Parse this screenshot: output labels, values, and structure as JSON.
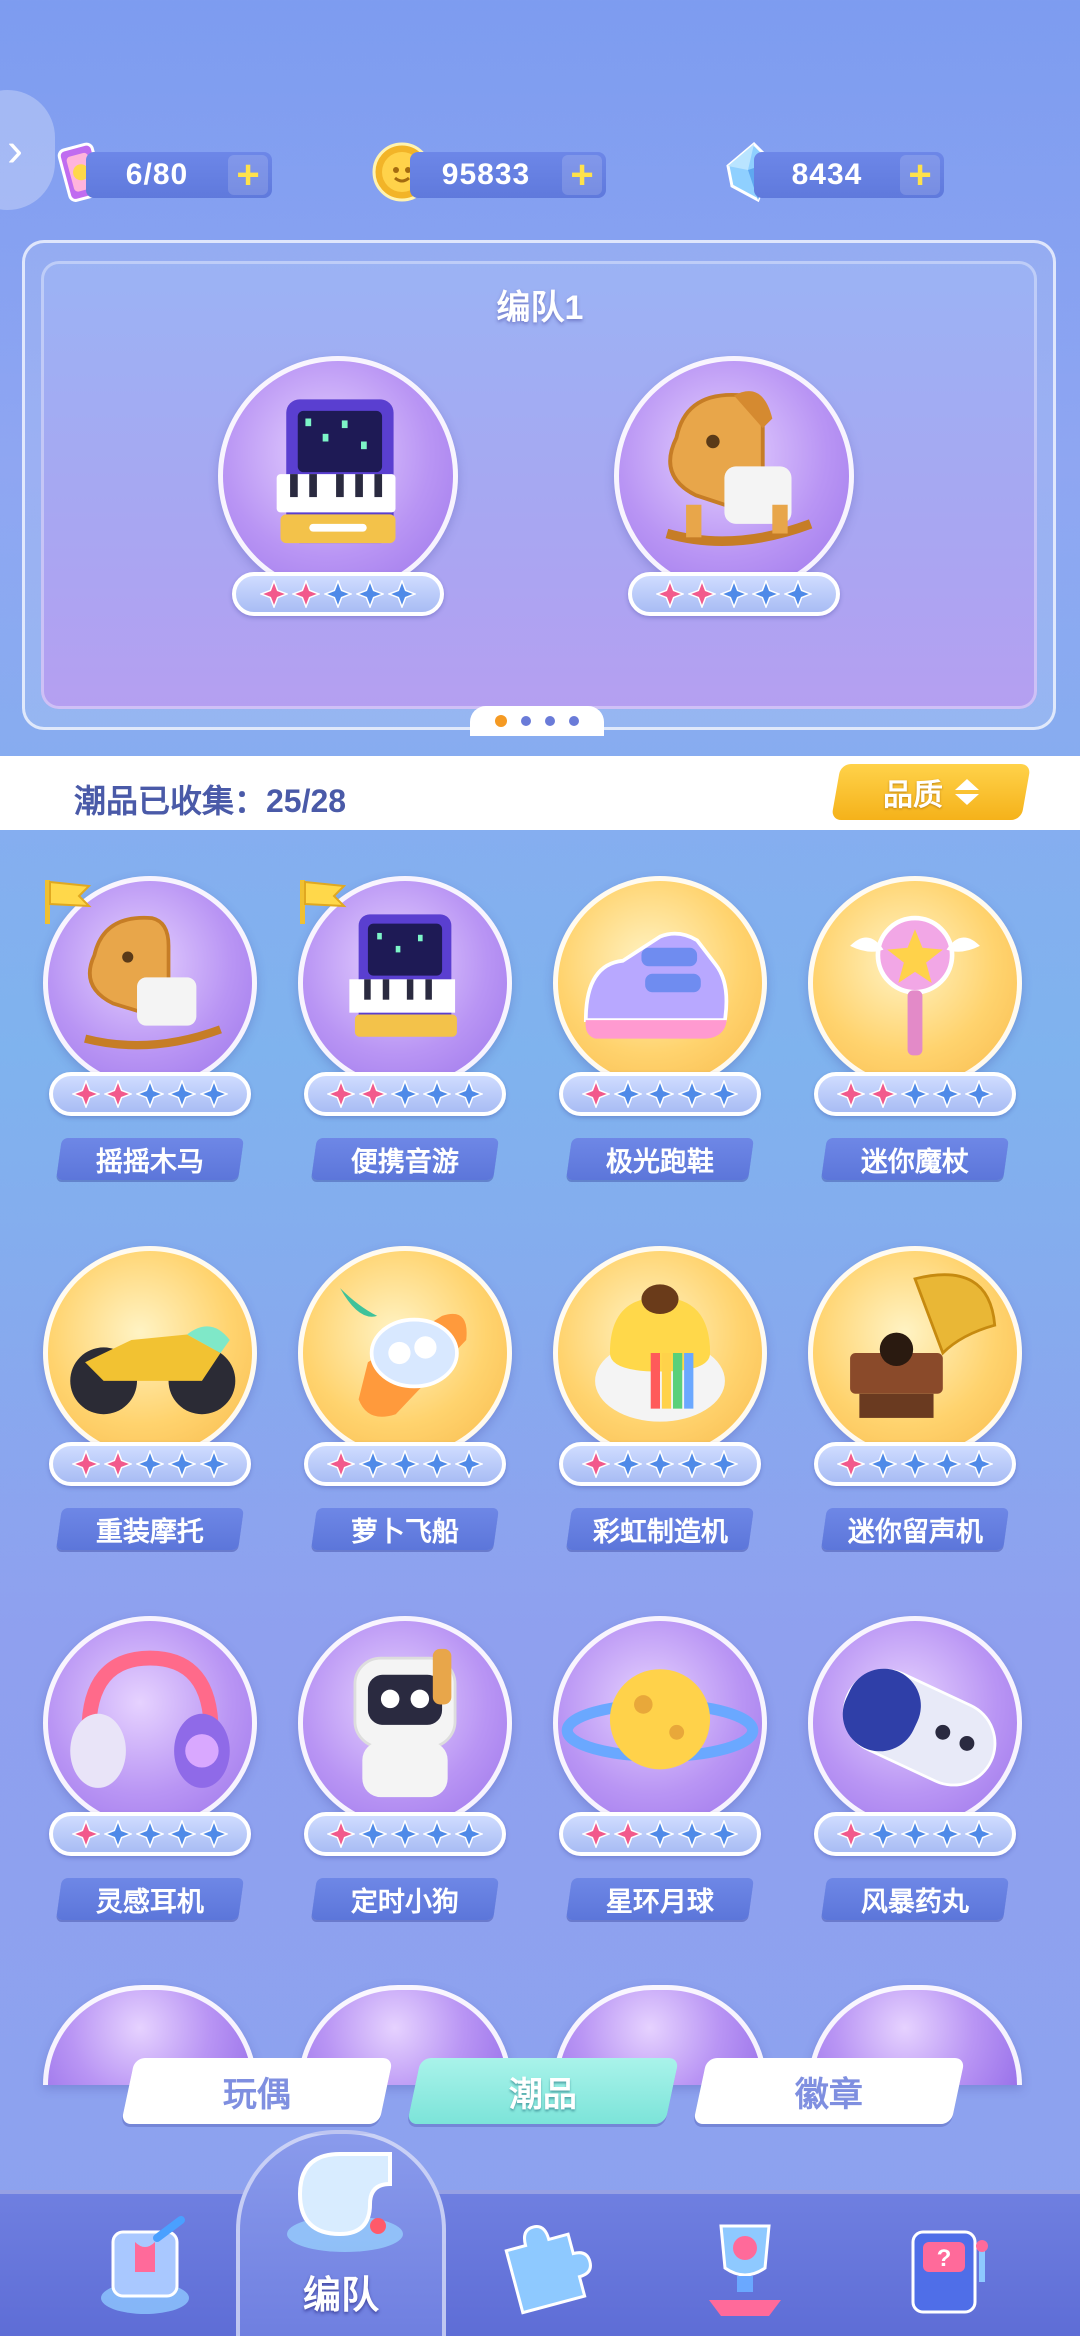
{
  "resources": {
    "energy": {
      "value": "6/80",
      "icon": "ticket-icon"
    },
    "coins": {
      "value": "95833",
      "icon": "coin-icon"
    },
    "gems": {
      "value": "8434",
      "icon": "crystal-icon"
    },
    "plus": "+"
  },
  "side_toggle": "›",
  "team": {
    "title": "编队1",
    "pages": 4,
    "active_page": 1,
    "slots": [
      {
        "item": "便携音游",
        "stars": 2,
        "max_stars": 5
      },
      {
        "item": "摇摇木马",
        "stars": 2,
        "max_stars": 5
      }
    ]
  },
  "collection": {
    "label": "潮品已收集：25/28",
    "sort_button": "品质"
  },
  "items": [
    {
      "name": "摇摇木马",
      "stars": 2,
      "bg": "purple",
      "flag": true
    },
    {
      "name": "便携音游",
      "stars": 2,
      "bg": "purple",
      "flag": true
    },
    {
      "name": "极光跑鞋",
      "stars": 1,
      "bg": "gold",
      "flag": false
    },
    {
      "name": "迷你魔杖",
      "stars": 2,
      "bg": "gold",
      "flag": false
    },
    {
      "name": "重装摩托",
      "stars": 2,
      "bg": "gold",
      "flag": false
    },
    {
      "name": "萝卜飞船",
      "stars": 1,
      "bg": "gold",
      "flag": false
    },
    {
      "name": "彩虹制造机",
      "stars": 1,
      "bg": "gold",
      "flag": false
    },
    {
      "name": "迷你留声机",
      "stars": 1,
      "bg": "gold",
      "flag": false
    },
    {
      "name": "灵感耳机",
      "stars": 1,
      "bg": "purple",
      "flag": false
    },
    {
      "name": "定时小狗",
      "stars": 1,
      "bg": "purple",
      "flag": false
    },
    {
      "name": "星环月球",
      "stars": 2,
      "bg": "purple",
      "flag": false
    },
    {
      "name": "风暴药丸",
      "stars": 1,
      "bg": "purple",
      "flag": false
    }
  ],
  "tabs": [
    {
      "label": "玩偶",
      "active": false
    },
    {
      "label": "潮品",
      "active": true
    },
    {
      "label": "徽章",
      "active": false
    }
  ],
  "bottom_nav": {
    "active_label": "编队",
    "items": [
      "rocket-icon",
      "whistle-icon",
      "puzzle-icon",
      "trophy-icon",
      "slot-machine-icon"
    ]
  },
  "colors": {
    "star_on": "#f25a8c",
    "star_off": "#4f8ae8",
    "accent_gold": "#f5b21a",
    "tab_active": "#7ce4d9"
  }
}
